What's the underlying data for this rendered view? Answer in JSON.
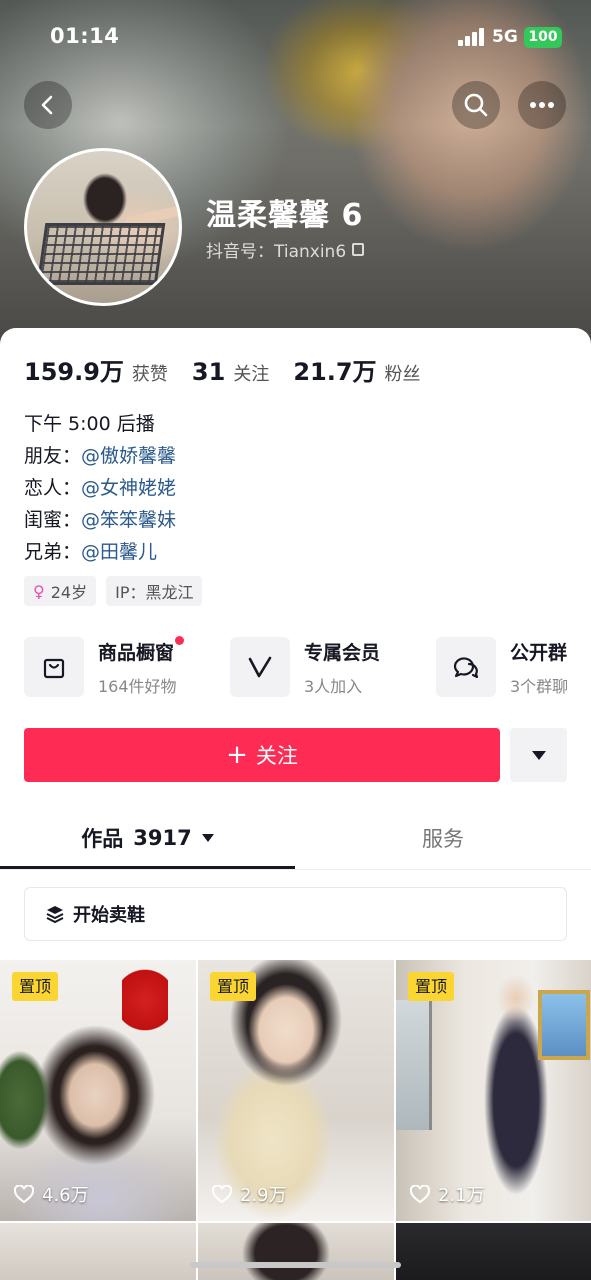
{
  "status_bar": {
    "time": "01:14",
    "network": "5G",
    "battery": "100",
    "battery_color": "#34c759"
  },
  "nav": {
    "back_icon": "chevron-left-icon",
    "search_icon": "search-icon",
    "more_icon": "more-dots-icon"
  },
  "profile": {
    "nickname": "温柔馨馨 6",
    "douyin_id": "抖音号：Tianxin6"
  },
  "stats": [
    {
      "value": "159.9万",
      "label": "获赞"
    },
    {
      "value": "31",
      "label": "关注"
    },
    {
      "value": "21.7万",
      "label": "粉丝"
    }
  ],
  "bio": {
    "line1": "下午 5:00 后播",
    "relations": [
      {
        "label": "朋友：",
        "mention": "@傲娇馨馨"
      },
      {
        "label": "恋人：",
        "mention": "@女神姥姥"
      },
      {
        "label": "闺蜜：",
        "mention": "@笨笨馨妹"
      },
      {
        "label": "兄弟：",
        "mention": "@田馨儿"
      }
    ]
  },
  "tags": {
    "age": "24岁",
    "ip": "IP：黑龙江"
  },
  "services": [
    {
      "title": "商品橱窗",
      "subtitle": "164件好物",
      "icon": "shopping-bag-icon",
      "has_dot": true
    },
    {
      "title": "专属会员",
      "subtitle": "3人加入",
      "icon": "vip-v-icon",
      "has_dot": false
    },
    {
      "title": "公开群",
      "subtitle": "3个群聊",
      "icon": "group-chat-icon",
      "has_dot": false
    }
  ],
  "actions": {
    "follow_label": "关注",
    "follow_color": "#fe2c55"
  },
  "tabs": {
    "works_label": "作品",
    "works_count": "3917",
    "service_label": "服务"
  },
  "collection": {
    "label": "开始卖鞋"
  },
  "videos": [
    {
      "pinned_label": "置顶",
      "likes": "4.6万"
    },
    {
      "pinned_label": "置顶",
      "likes": "2.9万"
    },
    {
      "pinned_label": "置顶",
      "likes": "2.1万"
    }
  ]
}
